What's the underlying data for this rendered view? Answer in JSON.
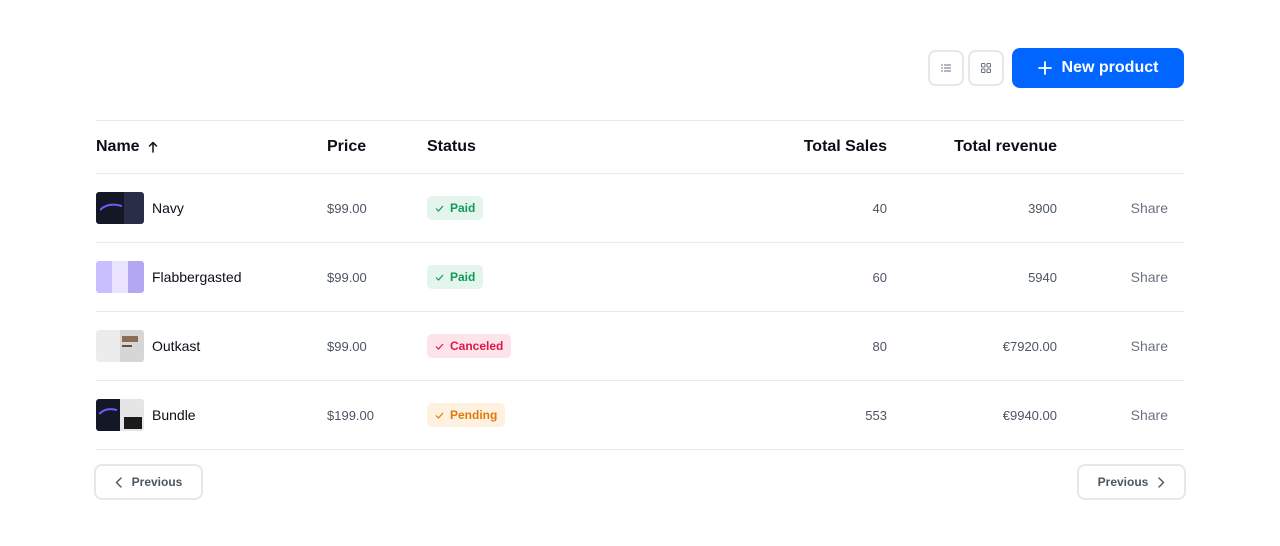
{
  "toolbar": {
    "list_icon": "list-icon",
    "grid_icon": "grid-icon",
    "new_product_label": "New product",
    "accent": "#0066ff"
  },
  "table": {
    "headers": {
      "name": "Name",
      "price": "Price",
      "status": "Status",
      "total_sales": "Total Sales",
      "total_revenue": "Total revenue"
    },
    "sort_icon": "arrow-up-icon",
    "rows": [
      {
        "name": "Navy",
        "price": "$99.00",
        "status": "Paid",
        "status_kind": "paid",
        "total_sales": "40",
        "total_revenue": "3900",
        "action": "Share"
      },
      {
        "name": "Flabbergasted",
        "price": "$99.00",
        "status": "Paid",
        "status_kind": "paid",
        "total_sales": "60",
        "total_revenue": "5940",
        "action": "Share"
      },
      {
        "name": "Outkast",
        "price": "$99.00",
        "status": "Canceled",
        "status_kind": "canceled",
        "total_sales": "80",
        "total_revenue": "€7920.00",
        "action": "Share"
      },
      {
        "name": "Bundle",
        "price": "$199.00",
        "status": "Pending",
        "status_kind": "pending",
        "total_sales": "553",
        "total_revenue": "€9940.00",
        "action": "Share"
      }
    ]
  },
  "pagination": {
    "prev_label": "Previous",
    "next_label": "Previous"
  },
  "colors": {
    "paid": "#129a5c",
    "canceled": "#e0154a",
    "pending": "#dd7a0c"
  }
}
